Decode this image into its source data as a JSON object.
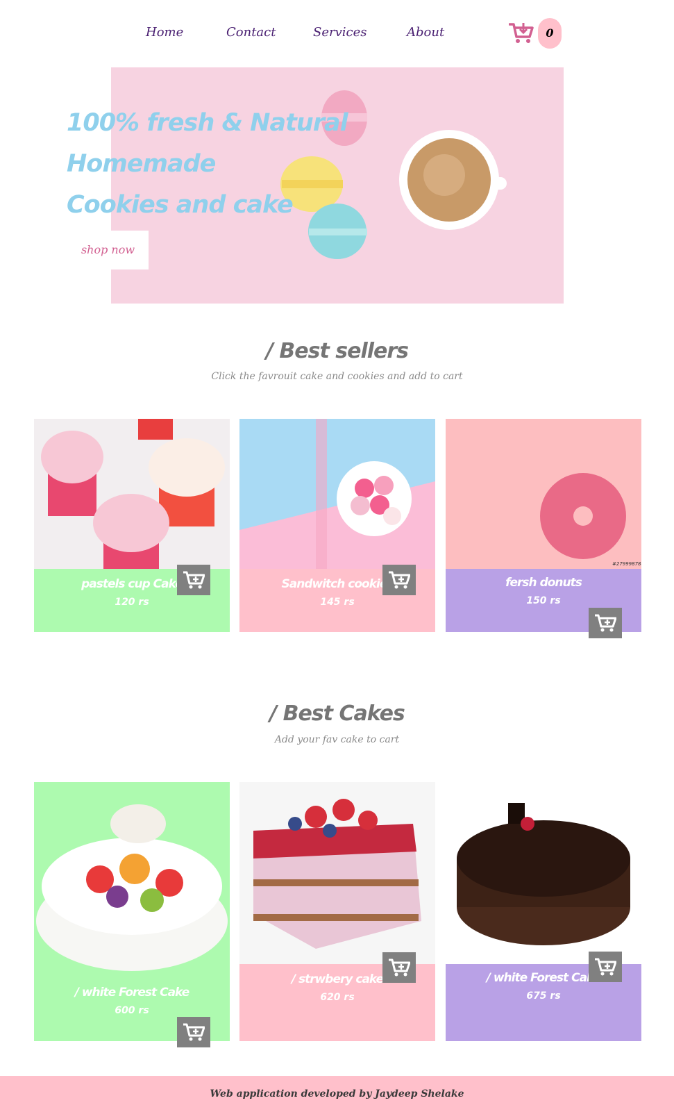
{
  "nav": {
    "links": [
      "Home",
      "Contact",
      "Services",
      "About"
    ],
    "cart_count": "0",
    "cart_icon": "cart-download-icon",
    "link_color": "#4a2072",
    "cart_color": "#d26091"
  },
  "hero": {
    "title_lines": [
      "100% fresh & Natural",
      "Homemade",
      "Cookies and cake"
    ],
    "button_label": "shop now",
    "background": "#f7d3e1",
    "title_color": "#8fd0ec"
  },
  "best_sellers": {
    "title": "/ Best sellers",
    "subtitle": "Click the favrouit cake and cookies and add to cart",
    "items": [
      {
        "name": "pastels cup Cake",
        "price": "120 rs",
        "color": "#adfaaf"
      },
      {
        "name": "Sandwitch cookies",
        "price": "145 rs",
        "color": "#ffc0cb"
      },
      {
        "name": "fersh donuts",
        "price": "150 rs",
        "color": "#b9a1e6"
      }
    ],
    "watermark": "#279998784"
  },
  "best_cakes": {
    "title": "/ Best Cakes",
    "subtitle": "Add your fav cake to cart",
    "items": [
      {
        "name": "/ white Forest Cake",
        "price": "600 rs",
        "color": "#adfaaf"
      },
      {
        "name": "/ strwbery cake",
        "price": "620 rs",
        "color": "#ffc0cb"
      },
      {
        "name": "/ white Forest Cake",
        "price": "675 rs",
        "color": "#b9a1e6"
      }
    ]
  },
  "footer": {
    "text": "Web application developed by Jaydeep Shelake"
  }
}
